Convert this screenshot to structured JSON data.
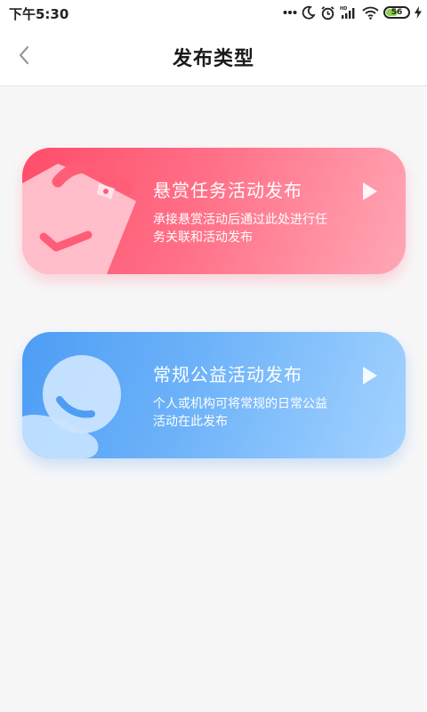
{
  "status_bar": {
    "time": "下午5:30",
    "battery_level": "56",
    "battery_fraction": 0.56
  },
  "header": {
    "title": "发布类型",
    "back_icon": "chevron-left-icon"
  },
  "cards": [
    {
      "title": "悬赏任务活动发布",
      "description": "承接悬赏活动后通过此处进行任务关联和活动发布",
      "icon": "reward-task-illustration",
      "arrow_icon": "play-arrow-icon"
    },
    {
      "title": "常规公益活动发布",
      "description": "个人或机构可将常规的日常公益活动在此发布",
      "icon": "charity-smile-illustration",
      "arrow_icon": "play-arrow-icon"
    }
  ],
  "colors": {
    "reward_start": "#ff4d6b",
    "reward_end": "#ffa7b6",
    "charity_start": "#4d9df5",
    "charity_end": "#a4d3ff",
    "background": "#f7f7f8"
  }
}
